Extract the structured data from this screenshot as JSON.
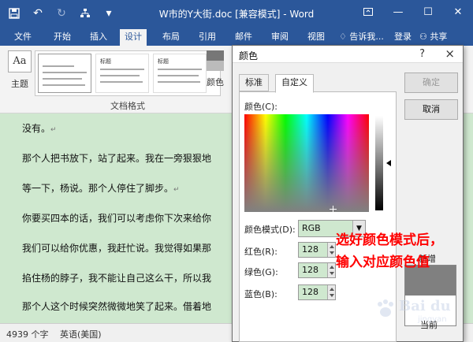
{
  "window": {
    "title": "W市的Y大街.doc [兼容模式] - Word",
    "quick_access": [
      "save-icon",
      "undo-icon",
      "redo-icon",
      "tree-icon",
      "dropdown-icon"
    ],
    "controls": [
      "ribbon-display-icon",
      "minimize-icon",
      "maximize-icon",
      "close-icon"
    ]
  },
  "ribbon": {
    "tabs": [
      "文件",
      "开始",
      "插入",
      "设计",
      "布局",
      "引用",
      "邮件",
      "审阅",
      "视图"
    ],
    "active_tab": "设计",
    "tell_me": "告诉我...",
    "login": "登录",
    "share": "共享",
    "theme_label": "主题",
    "theme_icon_text": "Aa",
    "gallery_label": "文档格式",
    "gallery_thumb_title": "标题",
    "colors_label": "颜色"
  },
  "document": {
    "lines": [
      "没有。",
      "那个人把书放下，站了起来。我在一旁狠狠地",
      "等一下，杨说。那个人停住了脚步。",
      "你要买四本的话，我们可以考虑你下次来给你",
      "我们可以给你优惠，我赶忙说。我觉得如果那",
      "掐住杨的脖子，我不能让自己这么干，所以我",
      "那个人这个时候突然微微地笑了起来。借着地"
    ],
    "paragraph_mark": "↵"
  },
  "status": {
    "word_count": "4939 个字",
    "language": "英语(美国)"
  },
  "dialog": {
    "title": "颜色",
    "help": "?",
    "close": "×",
    "tabs": [
      "标准",
      "自定义"
    ],
    "active_tab": "自定义",
    "colors_label": "颜色(C):",
    "mode_label": "颜色模式(D):",
    "mode_value": "RGB",
    "red_label": "红色(R):",
    "red_value": "128",
    "green_label": "绿色(G):",
    "green_value": "128",
    "blue_label": "蓝色(B):",
    "blue_value": "128",
    "ok": "确定",
    "cancel": "取消",
    "new_label": "新增",
    "current_label": "当前",
    "new_color": "#808080",
    "current_color": "#ffffff"
  },
  "annotation": {
    "line1": "选好颜色模式后，",
    "line2": "输入对应颜色值",
    "color": "#ff0000"
  },
  "watermark": {
    "text": "Bai du",
    "sub": "jingyan"
  },
  "colors": {
    "word_blue": "#2b579a",
    "doc_background": "#cfe8cf"
  }
}
